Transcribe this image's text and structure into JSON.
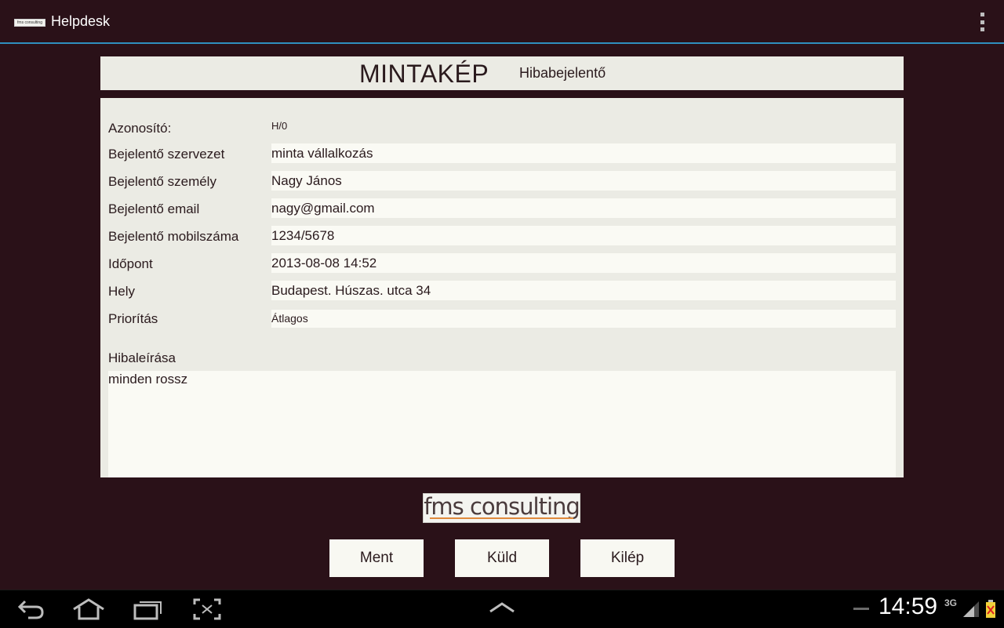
{
  "app": {
    "title": "Helpdesk",
    "logo_text": "fms consulting"
  },
  "header": {
    "brand": "MINTAKÉP",
    "subtitle": "Hibabejelentő"
  },
  "form": {
    "id_label": "Azonosító:",
    "id_value": "H/0",
    "fields": [
      {
        "label": "Bejelentő szervezet",
        "value": "minta vállalkozás"
      },
      {
        "label": "Bejelentő személy",
        "value": "Nagy János"
      },
      {
        "label": "Bejelentő email",
        "value": "nagy@gmail.com"
      },
      {
        "label": "Bejelentő mobilszáma",
        "value": "1234/5678"
      },
      {
        "label": "Időpont",
        "value": "2013-08-08 14:52"
      },
      {
        "label": "Hely",
        "value": "Budapest. Húszas. utca 34"
      },
      {
        "label": "Priorítás",
        "value": "Átlagos"
      }
    ],
    "description_label": "Hibaleírása",
    "description_value": "minden rossz"
  },
  "footer": {
    "logo_text": "fms consulting",
    "buttons": {
      "save": "Ment",
      "send": "Küld",
      "exit": "Kilép"
    }
  },
  "system_bar": {
    "time": "14:59",
    "network": "3G",
    "icons": [
      "back-icon",
      "home-icon",
      "recent-apps-icon",
      "screenshot-icon",
      "up-arrow-icon",
      "signal-icon",
      "battery-icon"
    ]
  },
  "colors": {
    "background": "#2a1118",
    "panel": "#ebebe4",
    "field": "#fafaf4",
    "accent_line": "#2f8fbf",
    "logo_underline": "#e08a3c"
  }
}
